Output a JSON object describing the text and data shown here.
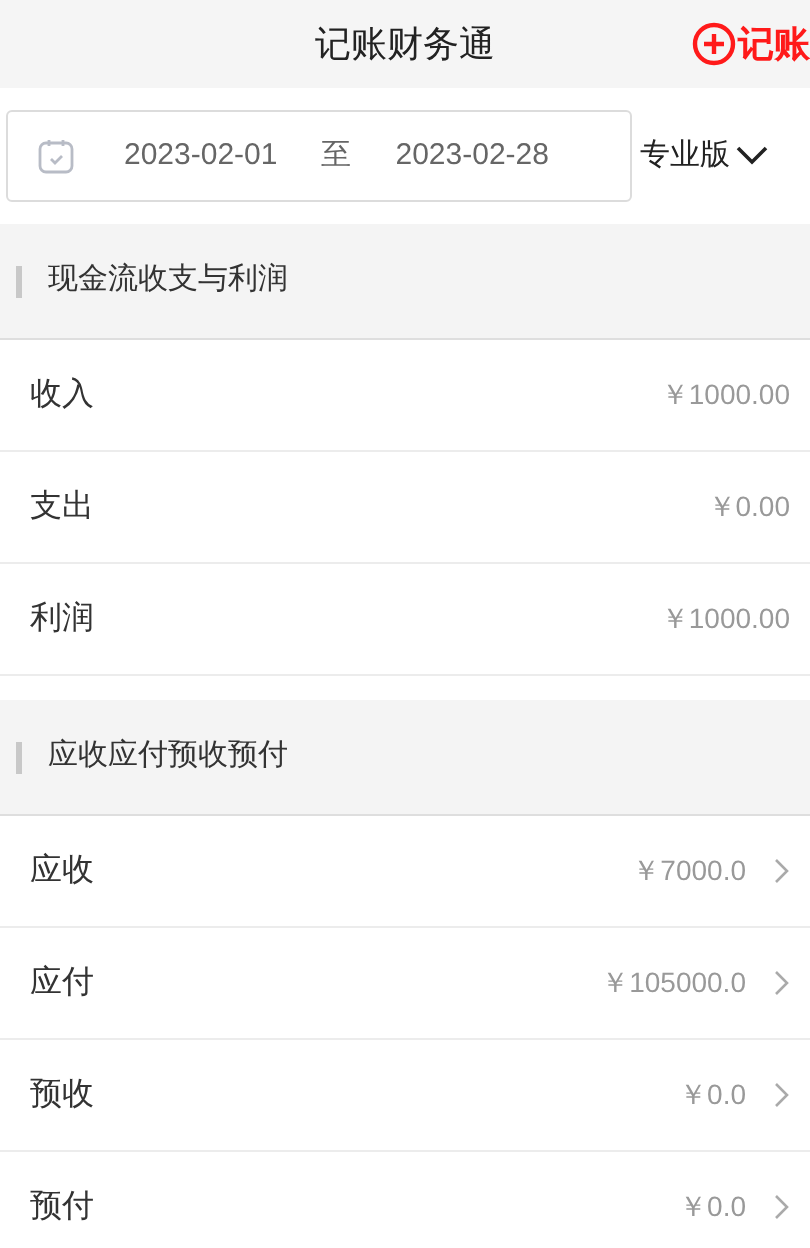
{
  "header": {
    "title": "记账财务通",
    "action": "记账"
  },
  "date_range": {
    "start": "2023-02-01",
    "separator": "至",
    "end": "2023-02-28"
  },
  "edition": {
    "label": "专业版"
  },
  "sections": [
    {
      "title": "现金流收支与利润",
      "rows": [
        {
          "label": "收入",
          "value": "￥1000.00",
          "kind": "plain"
        },
        {
          "label": "支出",
          "value": "￥0.00",
          "kind": "plain"
        },
        {
          "label": "利润",
          "value": "￥1000.00",
          "kind": "plain"
        }
      ]
    },
    {
      "title": "应收应付预收预付",
      "rows": [
        {
          "label": "应收",
          "value": "￥7000.0",
          "kind": "link"
        },
        {
          "label": "应付",
          "value": "￥105000.0",
          "kind": "link"
        },
        {
          "label": "预收",
          "value": "￥0.0",
          "kind": "link"
        },
        {
          "label": "预付",
          "value": "￥0.0",
          "kind": "link"
        }
      ]
    }
  ]
}
